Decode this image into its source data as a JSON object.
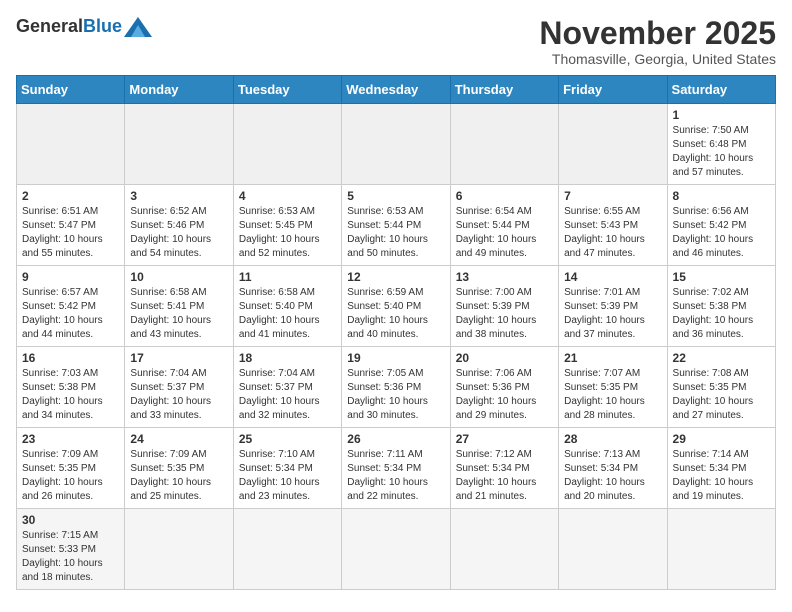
{
  "header": {
    "logo_general": "General",
    "logo_blue": "Blue",
    "month": "November 2025",
    "location": "Thomasville, Georgia, United States"
  },
  "days_of_week": [
    "Sunday",
    "Monday",
    "Tuesday",
    "Wednesday",
    "Thursday",
    "Friday",
    "Saturday"
  ],
  "weeks": [
    [
      {
        "day": "",
        "info": ""
      },
      {
        "day": "",
        "info": ""
      },
      {
        "day": "",
        "info": ""
      },
      {
        "day": "",
        "info": ""
      },
      {
        "day": "",
        "info": ""
      },
      {
        "day": "",
        "info": ""
      },
      {
        "day": "1",
        "info": "Sunrise: 7:50 AM\nSunset: 6:48 PM\nDaylight: 10 hours and 57 minutes."
      }
    ],
    [
      {
        "day": "2",
        "info": "Sunrise: 6:51 AM\nSunset: 5:47 PM\nDaylight: 10 hours and 55 minutes."
      },
      {
        "day": "3",
        "info": "Sunrise: 6:52 AM\nSunset: 5:46 PM\nDaylight: 10 hours and 54 minutes."
      },
      {
        "day": "4",
        "info": "Sunrise: 6:53 AM\nSunset: 5:45 PM\nDaylight: 10 hours and 52 minutes."
      },
      {
        "day": "5",
        "info": "Sunrise: 6:53 AM\nSunset: 5:44 PM\nDaylight: 10 hours and 50 minutes."
      },
      {
        "day": "6",
        "info": "Sunrise: 6:54 AM\nSunset: 5:44 PM\nDaylight: 10 hours and 49 minutes."
      },
      {
        "day": "7",
        "info": "Sunrise: 6:55 AM\nSunset: 5:43 PM\nDaylight: 10 hours and 47 minutes."
      },
      {
        "day": "8",
        "info": "Sunrise: 6:56 AM\nSunset: 5:42 PM\nDaylight: 10 hours and 46 minutes."
      }
    ],
    [
      {
        "day": "9",
        "info": "Sunrise: 6:57 AM\nSunset: 5:42 PM\nDaylight: 10 hours and 44 minutes."
      },
      {
        "day": "10",
        "info": "Sunrise: 6:58 AM\nSunset: 5:41 PM\nDaylight: 10 hours and 43 minutes."
      },
      {
        "day": "11",
        "info": "Sunrise: 6:58 AM\nSunset: 5:40 PM\nDaylight: 10 hours and 41 minutes."
      },
      {
        "day": "12",
        "info": "Sunrise: 6:59 AM\nSunset: 5:40 PM\nDaylight: 10 hours and 40 minutes."
      },
      {
        "day": "13",
        "info": "Sunrise: 7:00 AM\nSunset: 5:39 PM\nDaylight: 10 hours and 38 minutes."
      },
      {
        "day": "14",
        "info": "Sunrise: 7:01 AM\nSunset: 5:39 PM\nDaylight: 10 hours and 37 minutes."
      },
      {
        "day": "15",
        "info": "Sunrise: 7:02 AM\nSunset: 5:38 PM\nDaylight: 10 hours and 36 minutes."
      }
    ],
    [
      {
        "day": "16",
        "info": "Sunrise: 7:03 AM\nSunset: 5:38 PM\nDaylight: 10 hours and 34 minutes."
      },
      {
        "day": "17",
        "info": "Sunrise: 7:04 AM\nSunset: 5:37 PM\nDaylight: 10 hours and 33 minutes."
      },
      {
        "day": "18",
        "info": "Sunrise: 7:04 AM\nSunset: 5:37 PM\nDaylight: 10 hours and 32 minutes."
      },
      {
        "day": "19",
        "info": "Sunrise: 7:05 AM\nSunset: 5:36 PM\nDaylight: 10 hours and 30 minutes."
      },
      {
        "day": "20",
        "info": "Sunrise: 7:06 AM\nSunset: 5:36 PM\nDaylight: 10 hours and 29 minutes."
      },
      {
        "day": "21",
        "info": "Sunrise: 7:07 AM\nSunset: 5:35 PM\nDaylight: 10 hours and 28 minutes."
      },
      {
        "day": "22",
        "info": "Sunrise: 7:08 AM\nSunset: 5:35 PM\nDaylight: 10 hours and 27 minutes."
      }
    ],
    [
      {
        "day": "23",
        "info": "Sunrise: 7:09 AM\nSunset: 5:35 PM\nDaylight: 10 hours and 26 minutes."
      },
      {
        "day": "24",
        "info": "Sunrise: 7:09 AM\nSunset: 5:35 PM\nDaylight: 10 hours and 25 minutes."
      },
      {
        "day": "25",
        "info": "Sunrise: 7:10 AM\nSunset: 5:34 PM\nDaylight: 10 hours and 23 minutes."
      },
      {
        "day": "26",
        "info": "Sunrise: 7:11 AM\nSunset: 5:34 PM\nDaylight: 10 hours and 22 minutes."
      },
      {
        "day": "27",
        "info": "Sunrise: 7:12 AM\nSunset: 5:34 PM\nDaylight: 10 hours and 21 minutes."
      },
      {
        "day": "28",
        "info": "Sunrise: 7:13 AM\nSunset: 5:34 PM\nDaylight: 10 hours and 20 minutes."
      },
      {
        "day": "29",
        "info": "Sunrise: 7:14 AM\nSunset: 5:34 PM\nDaylight: 10 hours and 19 minutes."
      }
    ],
    [
      {
        "day": "30",
        "info": "Sunrise: 7:15 AM\nSunset: 5:33 PM\nDaylight: 10 hours and 18 minutes."
      },
      {
        "day": "",
        "info": ""
      },
      {
        "day": "",
        "info": ""
      },
      {
        "day": "",
        "info": ""
      },
      {
        "day": "",
        "info": ""
      },
      {
        "day": "",
        "info": ""
      },
      {
        "day": "",
        "info": ""
      }
    ]
  ]
}
